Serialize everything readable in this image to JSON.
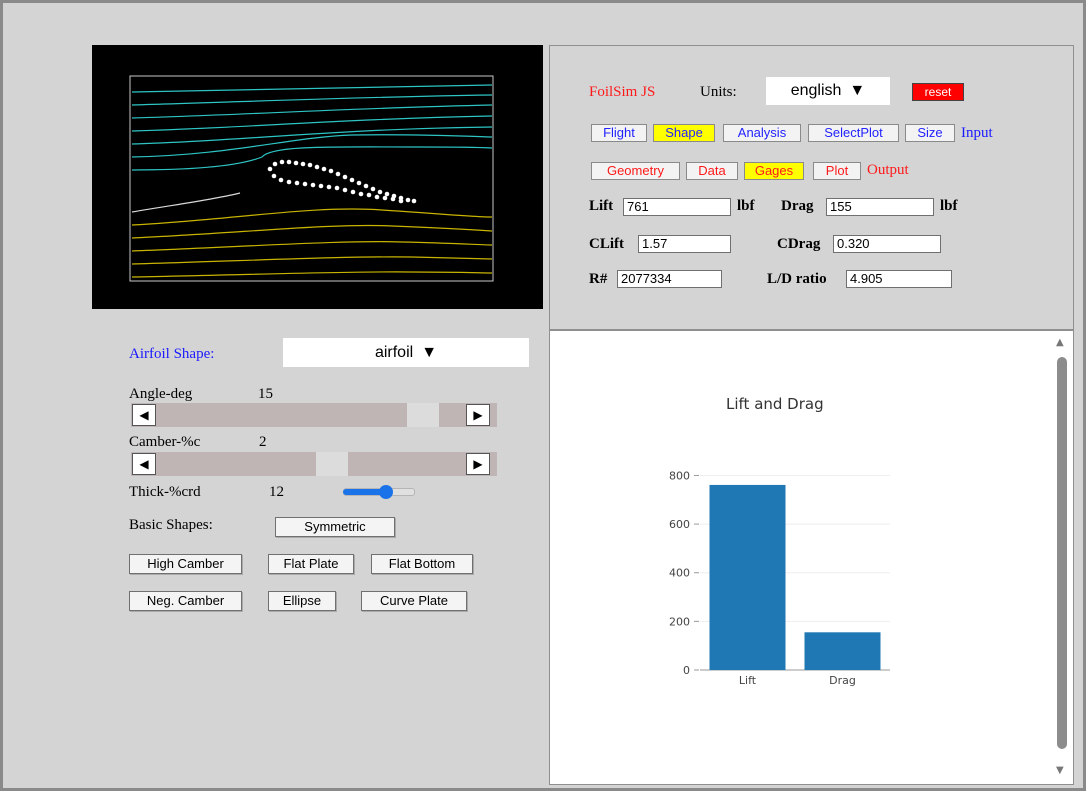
{
  "app": {
    "title": "FoilSim JS"
  },
  "units": {
    "label": "Units:",
    "value": "english"
  },
  "reset_label": "reset",
  "input_tabs": {
    "tabs": [
      {
        "label": "Flight",
        "selected": false
      },
      {
        "label": "Shape",
        "selected": true
      },
      {
        "label": "Analysis",
        "selected": false
      },
      {
        "label": "SelectPlot",
        "selected": false
      },
      {
        "label": "Size",
        "selected": false
      }
    ],
    "group_label": "Input"
  },
  "output_tabs": {
    "tabs": [
      {
        "label": "Geometry",
        "selected": false
      },
      {
        "label": "Data",
        "selected": false
      },
      {
        "label": "Gages",
        "selected": true
      },
      {
        "label": "Plot",
        "selected": false
      }
    ],
    "group_label": "Output"
  },
  "outputs": {
    "lift": {
      "label": "Lift",
      "value": "761",
      "unit": "lbf"
    },
    "drag": {
      "label": "Drag",
      "value": "155",
      "unit": "lbf"
    },
    "clift": {
      "label": "CLift",
      "value": "1.57"
    },
    "cdrag": {
      "label": "CDrag",
      "value": "0.320"
    },
    "reynolds": {
      "label": "R#",
      "value": "2077334"
    },
    "ld_ratio": {
      "label": "L/D ratio",
      "value": "4.905"
    }
  },
  "shape_panel": {
    "airfoil_shape_label": "Airfoil Shape:",
    "airfoil_shape_value": "airfoil",
    "angle": {
      "label": "Angle-deg",
      "value": "15"
    },
    "camber": {
      "label": "Camber-%c",
      "value": "2"
    },
    "thickness": {
      "label": "Thick-%crd",
      "value": "12"
    },
    "basic_shapes_label": "Basic Shapes:",
    "buttons": {
      "symmetric": "Symmetric",
      "high_camber": "High Camber",
      "flat_plate": "Flat Plate",
      "flat_bottom": "Flat Bottom",
      "neg_camber": "Neg. Camber",
      "ellipse": "Ellipse",
      "curve_plate": "Curve Plate"
    }
  },
  "chart_data": {
    "type": "bar",
    "title": "Lift and Drag",
    "categories": [
      "Lift",
      "Drag"
    ],
    "values": [
      761,
      155
    ],
    "ylim": [
      0,
      880
    ],
    "yticks": [
      0,
      200,
      400,
      600,
      800
    ],
    "color": "#1f77b4",
    "grid": true
  },
  "colors": {
    "streamline_upper": "#2ec4c4",
    "streamline_lower": "#c8b400",
    "airfoil_dots": "#ffffff",
    "accent_red": "#ff1a1a",
    "accent_blue": "#1a1aff",
    "selected_tab": "#ffff00",
    "reset_bg": "#ff0000"
  }
}
